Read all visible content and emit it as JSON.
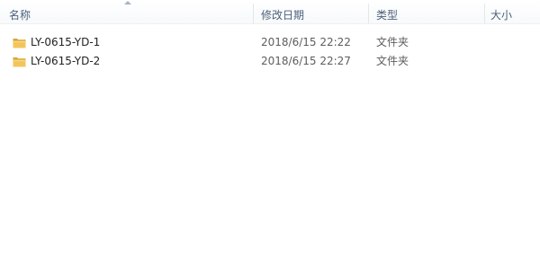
{
  "columns": {
    "name": "名称",
    "date_modified": "修改日期",
    "type": "类型",
    "size": "大小"
  },
  "files": [
    {
      "name": "LY-0615-YD-1",
      "date_modified": "2018/6/15 22:22",
      "type": "文件夹",
      "icon": "folder-icon"
    },
    {
      "name": "LY-0615-YD-2",
      "date_modified": "2018/6/15 22:27",
      "type": "文件夹",
      "icon": "folder-icon"
    }
  ],
  "colors": {
    "header_text": "#4c607a",
    "folder": "#e8b84a"
  }
}
